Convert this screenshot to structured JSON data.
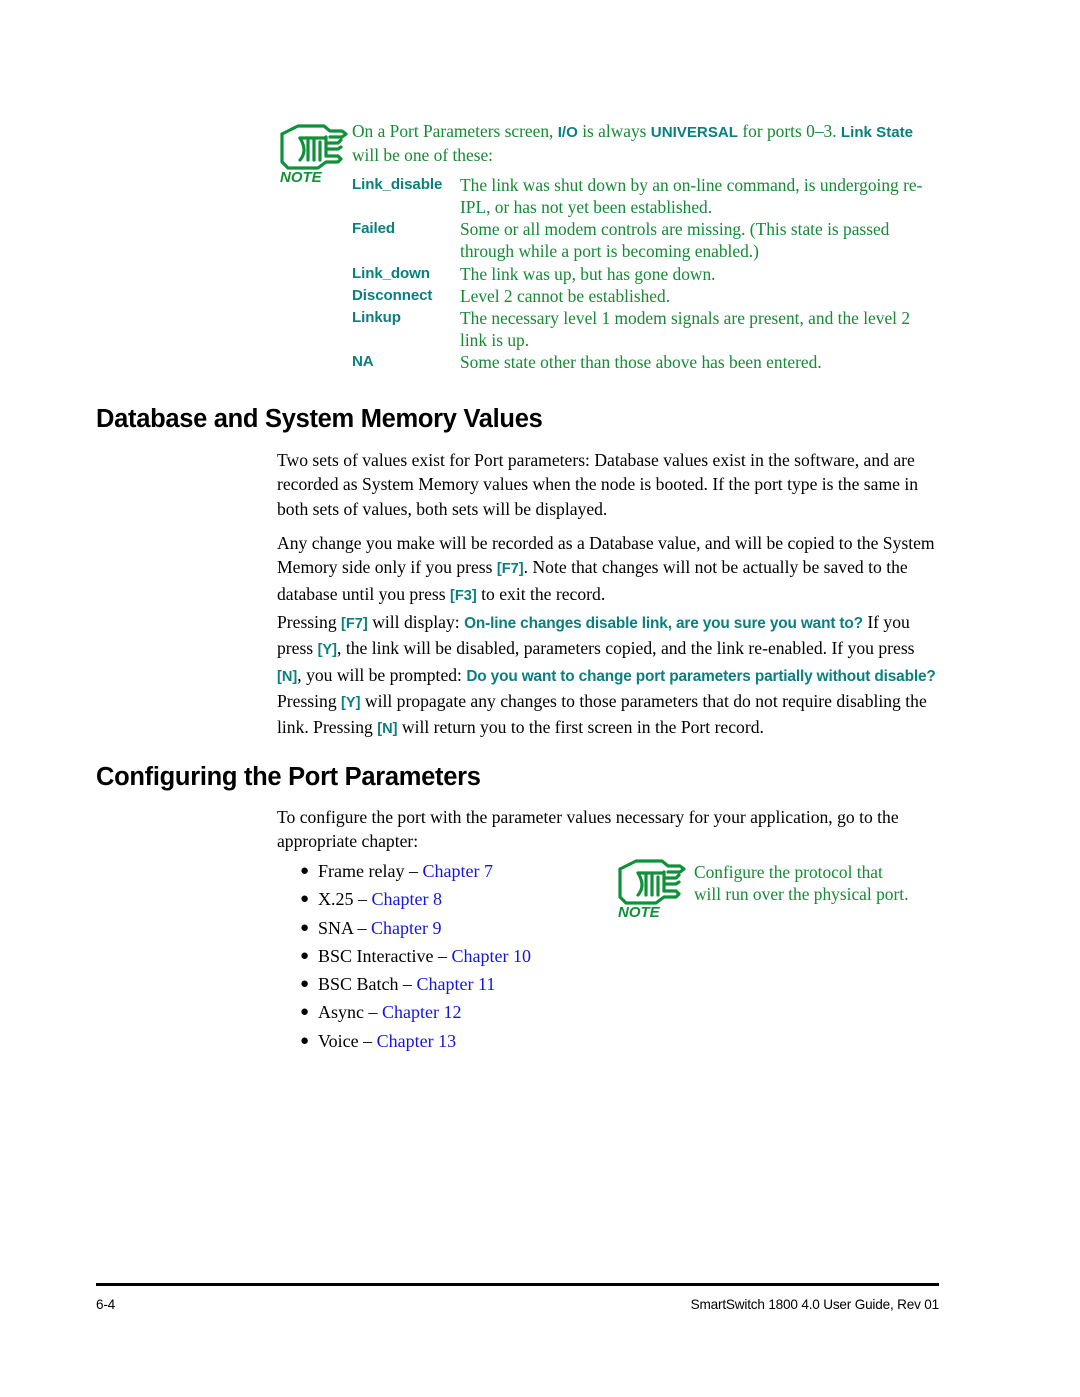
{
  "note_top": {
    "icon": "note-pointing-hand-icon",
    "icon_label": "NOTE",
    "intro_part1": "On a Port Parameters screen, ",
    "intro_kw1": "I/O",
    "intro_part2": " is always ",
    "intro_kw2": "UNIVERSAL",
    "intro_part3": " for ports 0–3. ",
    "intro_kw3": "Link State",
    "intro_part4": " will be one of these:",
    "definitions": [
      {
        "term": "Link_disable",
        "desc": "The link was shut down by an on-line command, is undergoing re-IPL, or has not yet been established."
      },
      {
        "term": "Failed",
        "desc": "Some or all modem controls are missing. (This state is passed through while a port is becoming enabled.)"
      },
      {
        "term": "Link_down",
        "desc": "The link was up, but has gone down."
      },
      {
        "term": "Disconnect",
        "desc": "Level 2 cannot be established."
      },
      {
        "term": "Linkup",
        "desc": "The necessary level 1 modem signals are present, and the level 2 link is up."
      },
      {
        "term": "NA",
        "desc": "Some state other than those above has been entered."
      }
    ]
  },
  "section1": {
    "heading": "Database and System Memory Values",
    "para1": "Two sets of values exist for Port parameters: Database values exist in the software, and are recorded as System Memory values when the node is booted. If the port type is the same in both sets of values, both sets will be displayed.",
    "para2": {
      "t1": "Any change you make will be recorded as a Database value, and will be copied to the System Memory side only if you press ",
      "k1": "[F7]",
      "t2": ". Note that changes will not be actually be saved to the database until you press ",
      "k2": "[F3]",
      "t3": " to exit the record."
    },
    "para3": {
      "t1": "Pressing ",
      "k1": "[F7]",
      "t2": " will display: ",
      "p1": "On-line changes disable link, are you sure you want to?",
      "t3": " If you press ",
      "k2": "[Y]",
      "t4": ", the link will be disabled, parameters copied, and the link re-enabled. If you press ",
      "k3": "[N]",
      "t5": ", you will be prompted: ",
      "p2": "Do you want to change port parameters partially without disable?",
      "t6": " Pressing ",
      "k4": "[Y]",
      "t7": " will propagate any changes to those parameters that do not require disabling the link. Pressing ",
      "k5": "[N]",
      "t8": " will return you to the first screen in the Port record."
    }
  },
  "section2": {
    "heading": "Configuring the Port Parameters",
    "para1": "To configure the port with the parameter values necessary for your application, go to the appropriate chapter:",
    "bullets": [
      {
        "label": "Frame relay –",
        "chapter": "Chapter 7"
      },
      {
        "label": "X.25 –",
        "chapter": "Chapter 8"
      },
      {
        "label": "SNA –",
        "chapter": "Chapter 9"
      },
      {
        "label": "BSC Interactive –",
        "chapter": "Chapter 10"
      },
      {
        "label": "BSC Batch –",
        "chapter": "Chapter 11"
      },
      {
        "label": "Async –",
        "chapter": "Chapter 12"
      },
      {
        "label": "Voice –",
        "chapter": "Chapter 13"
      }
    ]
  },
  "note_bottom": {
    "icon": "note-pointing-hand-icon",
    "icon_label": "NOTE",
    "line1": "Configure the protocol that",
    "line2": "will run over the physical port."
  },
  "footer": {
    "page_number": "6-4",
    "doc_title": "SmartSwitch 1800 4.0 User Guide, Rev 01"
  },
  "colors": {
    "note_green": "#158a34",
    "keyword_teal": "#0a7f7f",
    "link_blue": "#1414e0",
    "text_black": "#000000"
  }
}
